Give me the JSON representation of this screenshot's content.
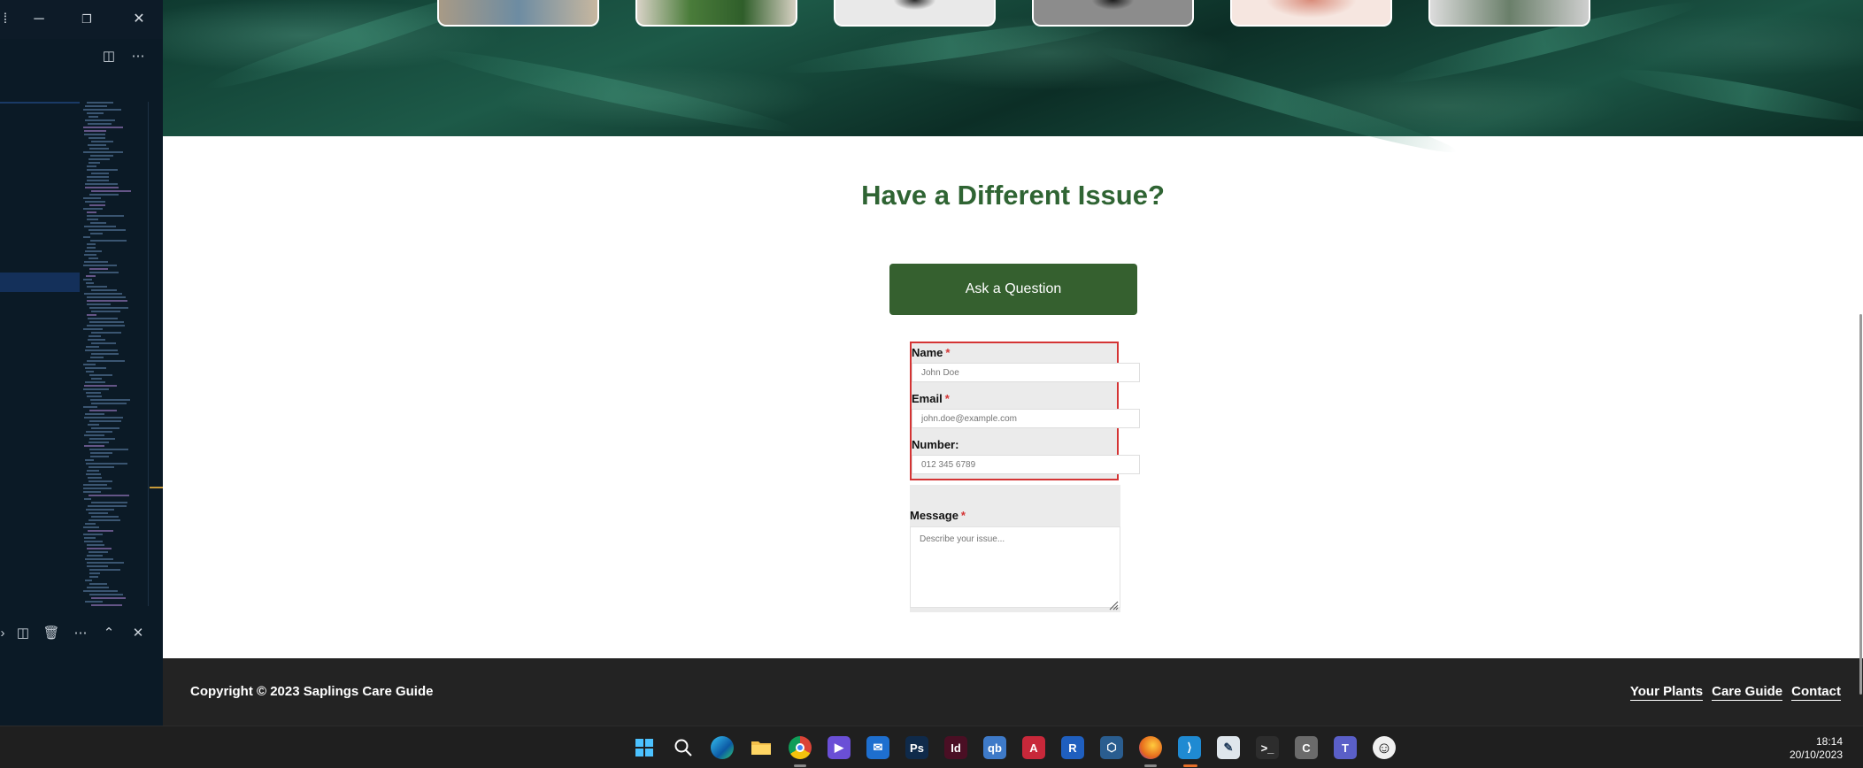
{
  "page": {
    "section_title": "Have a Different Issue?",
    "ask_button": "Ask a Question"
  },
  "form": {
    "name_label": "Name",
    "name_placeholder": "John Doe",
    "email_label": "Email",
    "email_placeholder": "john.doe@example.com",
    "number_label": "Number:",
    "number_placeholder": "012 345 6789",
    "message_label": "Message",
    "message_placeholder": "Describe your issue...",
    "required_mark": "*"
  },
  "footer": {
    "copyright": "Copyright © 2023 Saplings Care Guide",
    "nav": [
      "Your Plants",
      "Care Guide",
      "Contact"
    ]
  },
  "taskbar": {
    "time": "18:14",
    "date": "20/10/2023",
    "apps": [
      {
        "name": "start-icon",
        "glyph": "",
        "color": "#2b8ae6"
      },
      {
        "name": "search-icon",
        "glyph": "",
        "color": "transparent"
      },
      {
        "name": "edge-icon",
        "glyph": "e",
        "color": "#1a9fd8"
      },
      {
        "name": "file-explorer-icon",
        "glyph": "",
        "color": "#e8b93c"
      },
      {
        "name": "chrome-icon",
        "glyph": "",
        "color": "#db4437"
      },
      {
        "name": "media-player-icon",
        "glyph": "▶",
        "color": "#6a4fd6"
      },
      {
        "name": "mail-icon",
        "glyph": "✉",
        "color": "#1e6fcf"
      },
      {
        "name": "photoshop-icon",
        "glyph": "Ps",
        "color": "#0f2a4a"
      },
      {
        "name": "indesign-icon",
        "glyph": "Id",
        "color": "#4a0f24"
      },
      {
        "name": "qbittorrent-icon",
        "glyph": "qb",
        "color": "#3e7ac8"
      },
      {
        "name": "autocad-icon",
        "glyph": "A",
        "color": "#c8283a"
      },
      {
        "name": "revit-icon",
        "glyph": "R",
        "color": "#1f5fbf"
      },
      {
        "name": "virtualbox-icon",
        "glyph": "⬡",
        "color": "#2a5d8f"
      },
      {
        "name": "firefox-icon",
        "glyph": "",
        "color": "#e66a1c"
      },
      {
        "name": "vscode-icon",
        "glyph": "⟩",
        "color": "#1f8ad2"
      },
      {
        "name": "notepad-icon",
        "glyph": "✎",
        "color": "#dfe6ec"
      },
      {
        "name": "terminal-icon",
        "glyph": ">_",
        "color": "#2d2d2d"
      },
      {
        "name": "ccleaner-icon",
        "glyph": "C",
        "color": "#6b6b6b"
      },
      {
        "name": "teams-icon",
        "glyph": "T",
        "color": "#5a5fc8"
      },
      {
        "name": "emoji-app-icon",
        "glyph": "☺",
        "color": "#f0f0f0"
      }
    ]
  },
  "colors": {
    "brand_green": "#35602f",
    "title_green": "#2f6433",
    "footer_bg": "#232323",
    "form_outline": "#d43434"
  }
}
